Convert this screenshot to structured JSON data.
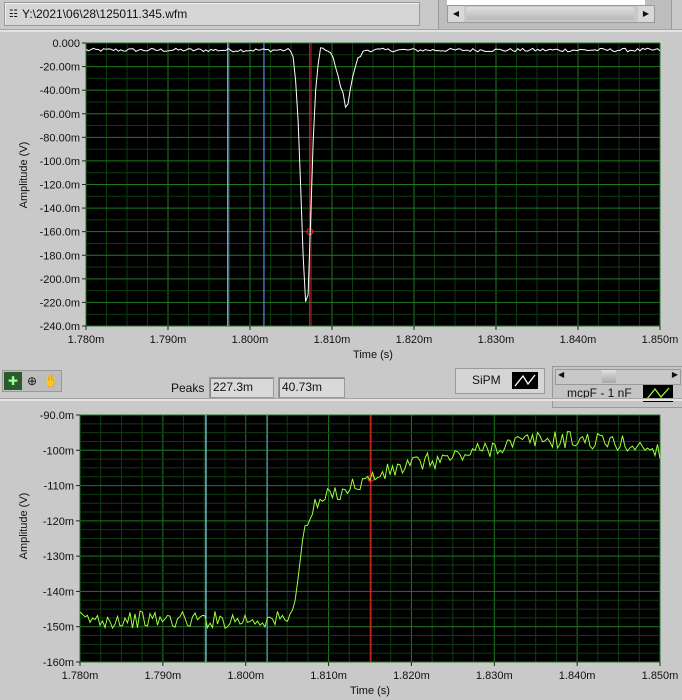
{
  "file_path": {
    "value": "Y:\\2021\\06\\28\\125011.345.wfm",
    "icon": "path-icon"
  },
  "toolbar": {
    "tools": [
      "cursor-tool-icon",
      "zoom-tool-icon",
      "pan-tool-icon"
    ]
  },
  "peaks": {
    "label": "Peaks",
    "value1": "227.3m",
    "value2": "40.73m"
  },
  "legend_top": {
    "name": "SiPM",
    "color": "#ffffff"
  },
  "legend_bottom": {
    "name": "mcpF - 1 nF",
    "color": "#9cff3c"
  },
  "chart_data": [
    {
      "type": "line",
      "xlabel": "Time (s)",
      "ylabel": "Amplitude (V)",
      "xlim": [
        0.00178,
        0.00185
      ],
      "ylim": [
        -0.24,
        0.0
      ],
      "xticks": [
        "1.780m",
        "1.790m",
        "1.800m",
        "1.810m",
        "1.820m",
        "1.830m",
        "1.840m",
        "1.850m"
      ],
      "yticks": [
        "0.000",
        "-20.00m",
        "-40.00m",
        "-60.00m",
        "-80.00m",
        "-100.0m",
        "-120.0m",
        "-140.0m",
        "-160.0m",
        "-180.0m",
        "-200.0m",
        "-220.0m",
        "-240.0m"
      ],
      "grid": true,
      "series": [
        {
          "name": "SiPM",
          "color": "#ffffff",
          "noise": 0.0015,
          "x": [
            1.78,
            1.805,
            1.8054,
            1.806,
            1.8064,
            1.8069,
            1.8072,
            1.8076,
            1.808,
            1.8085,
            1.809,
            1.81,
            1.8108,
            1.8114,
            1.8118,
            1.8122,
            1.813,
            1.814,
            1.85
          ],
          "y": [
            -0.006,
            -0.006,
            -0.015,
            -0.08,
            -0.17,
            -0.235,
            -0.2,
            -0.1,
            -0.04,
            -0.006,
            -0.004,
            -0.01,
            -0.03,
            -0.045,
            -0.058,
            -0.04,
            -0.015,
            -0.006,
            -0.006
          ]
        }
      ],
      "cursors": [
        {
          "color": "#8fe0ff",
          "x": 1.7973
        },
        {
          "color": "#4a90e2",
          "x": 1.8017
        },
        {
          "color": "#ff2020",
          "x": 1.8073,
          "y": -0.16
        }
      ]
    },
    {
      "type": "line",
      "xlabel": "Time (s)",
      "ylabel": "Amplitude (V)",
      "xlim": [
        0.00178,
        0.00185
      ],
      "ylim": [
        -0.16,
        -0.09
      ],
      "xticks": [
        "1.780m",
        "1.790m",
        "1.800m",
        "1.810m",
        "1.820m",
        "1.830m",
        "1.840m",
        "1.850m"
      ],
      "yticks": [
        "-90.0m",
        "-100m",
        "-110m",
        "-120m",
        "-130m",
        "-140m",
        "-150m",
        "-160m"
      ],
      "grid": true,
      "series": [
        {
          "name": "mcpF - 1 nF",
          "color": "#9cff3c",
          "noise": 0.0025,
          "x": [
            1.78,
            1.8054,
            1.806,
            1.807,
            1.808,
            1.81,
            1.812,
            1.815,
            1.82,
            1.825,
            1.83,
            1.835,
            1.84,
            1.845,
            1.85
          ],
          "y": [
            -0.148,
            -0.148,
            -0.14,
            -0.124,
            -0.117,
            -0.113,
            -0.111,
            -0.108,
            -0.104,
            -0.102,
            -0.099,
            -0.097,
            -0.097,
            -0.098,
            -0.1
          ]
        }
      ],
      "cursors": [
        {
          "color": "#8fe0ff",
          "x": 1.7952
        },
        {
          "color": "#4a90e2",
          "x": 1.8026
        },
        {
          "color": "#ff2020",
          "x": 1.8151,
          "y": -0.108
        }
      ]
    }
  ]
}
